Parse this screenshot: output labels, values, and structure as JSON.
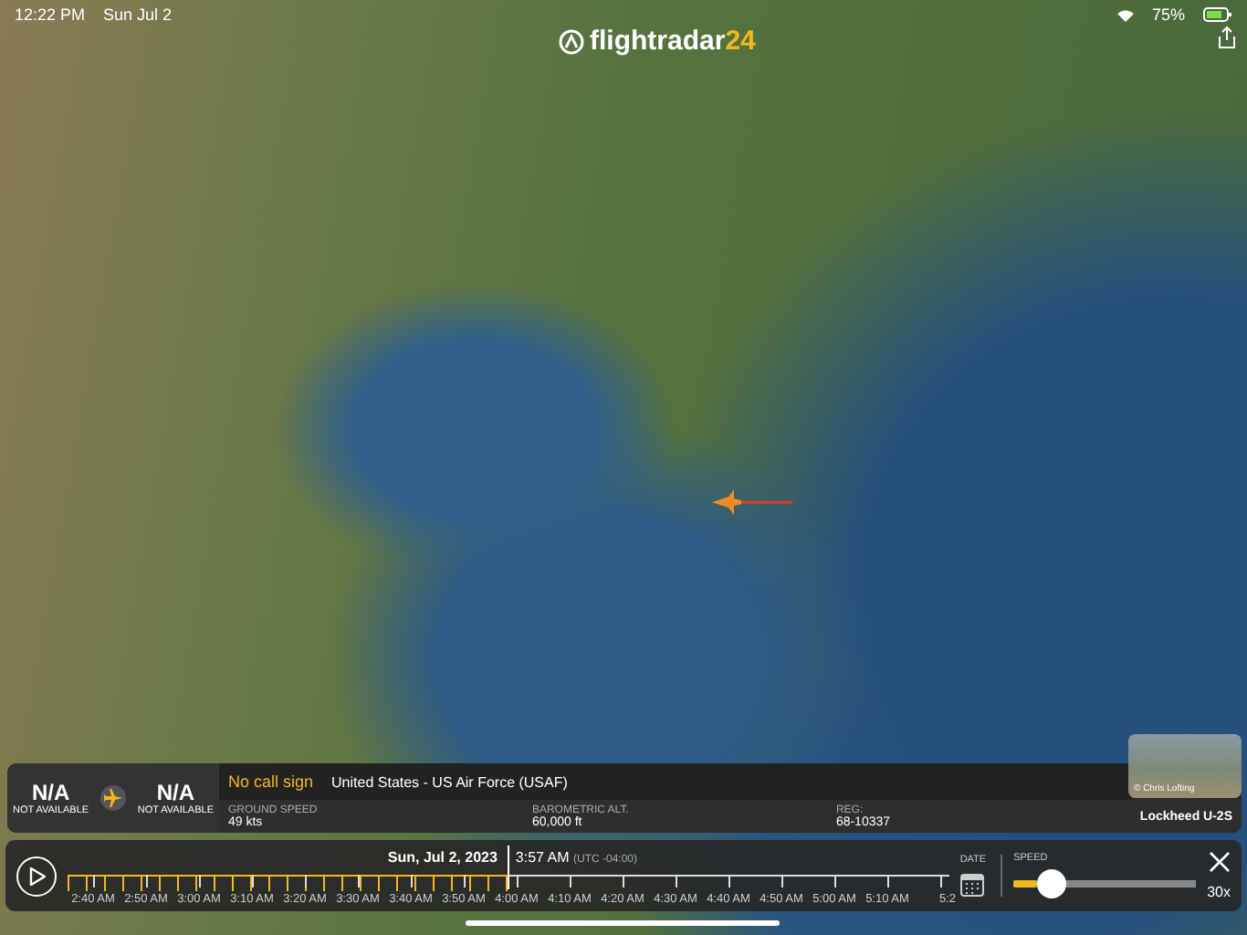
{
  "status_bar": {
    "time": "12:22 PM",
    "date": "Sun Jul 2",
    "battery": "75%"
  },
  "logo": {
    "text": "flightradar",
    "accent": "24"
  },
  "flight_panel": {
    "origin": {
      "code": "N/A",
      "label": "NOT AVAILABLE"
    },
    "destination": {
      "code": "N/A",
      "label": "NOT AVAILABLE"
    },
    "callsign": "No call sign",
    "operator": "United States - US Air Force (USAF)",
    "fields": [
      {
        "label": "GROUND SPEED",
        "value": "49 kts"
      },
      {
        "label": "BAROMETRIC ALT.",
        "value": "60,000 ft"
      },
      {
        "label": "REG:",
        "value": "68-10337"
      }
    ],
    "aircraft": "Lockheed U-2S",
    "photo_credit": "© Chris Lofting"
  },
  "playback": {
    "date": "Sun, Jul 2, 2023",
    "time": "3:57 AM",
    "timezone": "(UTC -04:00)",
    "level": 0.5,
    "ticks": [
      "2:40 AM",
      "2:50 AM",
      "3:00 AM",
      "3:10 AM",
      "3:20 AM",
      "3:30 AM",
      "3:40 AM",
      "3:50 AM",
      "4:00 AM",
      "4:10 AM",
      "4:20 AM",
      "4:30 AM",
      "4:40 AM",
      "4:50 AM",
      "5:00 AM",
      "5:10 AM",
      "5:2"
    ],
    "date_label": "DATE",
    "speed_label": "SPEED",
    "speed": {
      "level": 0.15,
      "value": "30x"
    }
  }
}
